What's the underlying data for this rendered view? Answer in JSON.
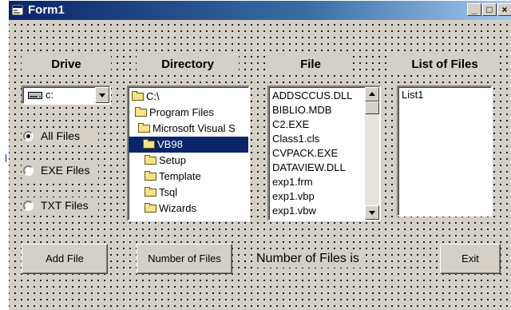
{
  "window": {
    "title": "Form1"
  },
  "window_controls": {
    "minimize": "_",
    "maximize": "□",
    "close": "×"
  },
  "labels": {
    "drive": "Drive",
    "directory": "Directory",
    "file": "File",
    "list_of_files": "List of Files"
  },
  "drive_combo": {
    "value": "c:"
  },
  "radios": [
    {
      "label": "All Files",
      "selected": true
    },
    {
      "label": "EXE Files",
      "selected": false
    },
    {
      "label": "TXT Files",
      "selected": false
    }
  ],
  "directories": [
    {
      "label": "C:\\",
      "selected": false
    },
    {
      "label": "Program Files",
      "selected": false
    },
    {
      "label": "Microsoft Visual S",
      "selected": false
    },
    {
      "label": "VB98",
      "selected": true
    },
    {
      "label": "Setup",
      "selected": false
    },
    {
      "label": "Template",
      "selected": false
    },
    {
      "label": "Tsql",
      "selected": false
    },
    {
      "label": "Wizards",
      "selected": false
    }
  ],
  "files": [
    "ADDSCCUS.DLL",
    "BIBLIO.MDB",
    "C2.EXE",
    "Class1.cls",
    "CVPACK.EXE",
    "DATAVIEW.DLL",
    "exp1.frm",
    "exp1.vbp",
    "exp1.vbw"
  ],
  "list_of_files": {
    "items": [
      "List1"
    ]
  },
  "buttons": {
    "add_file": "Add File",
    "number_of_files": "Number of Files",
    "exit": "Exit"
  },
  "status_label": "Number of Files is"
}
